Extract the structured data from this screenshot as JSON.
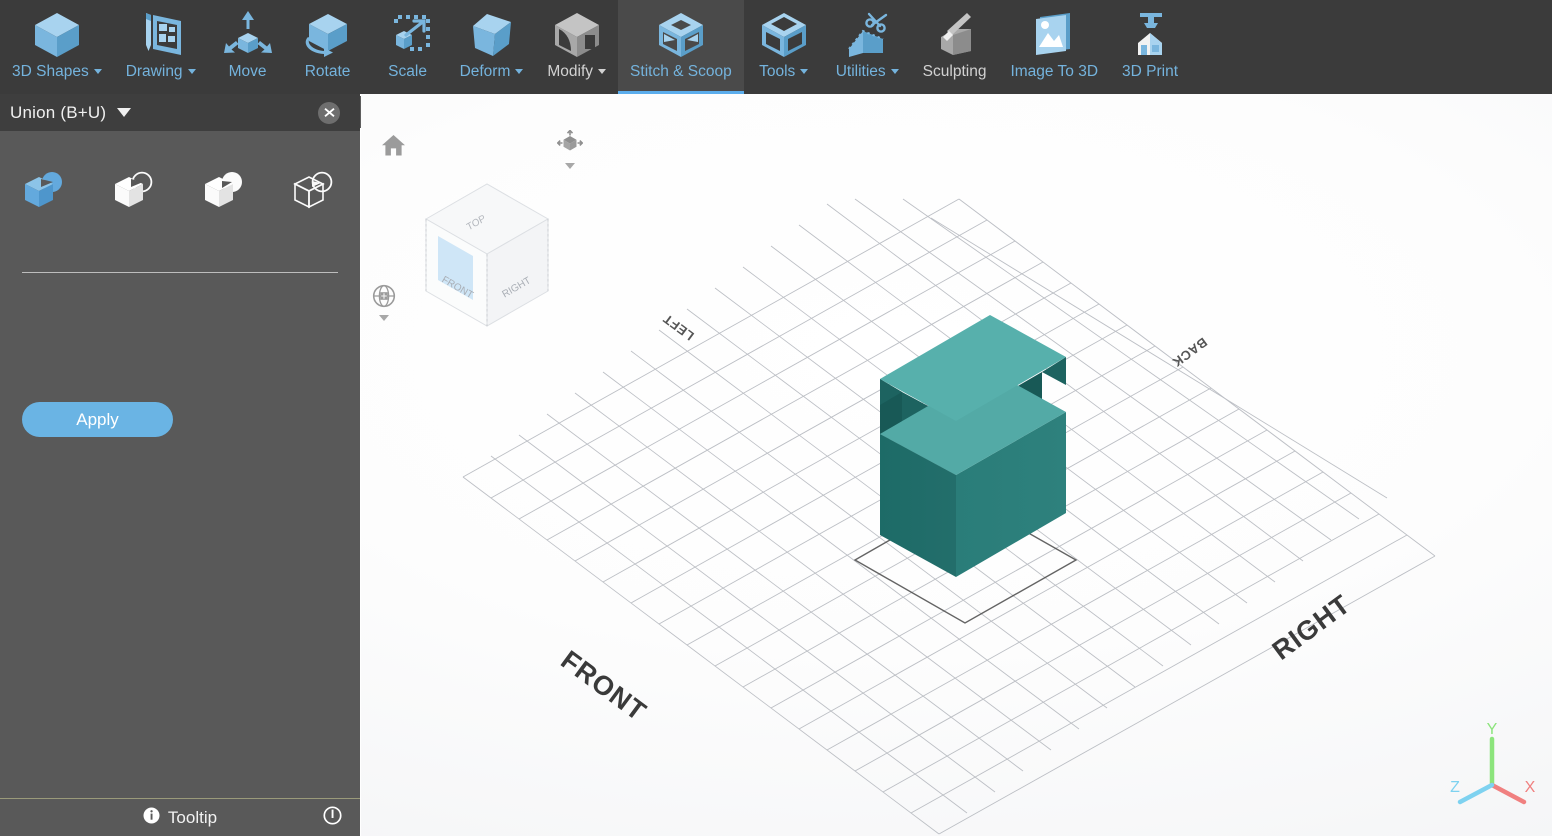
{
  "app": {
    "accent_blue": "#74b3dd",
    "toolbar_bg": "#3b3b3b",
    "panel_bg": "#595959",
    "apply_blue": "#6ab4e4",
    "model_color_top": "#53aaa6",
    "model_color_side": "#1f6b68"
  },
  "toolbar": {
    "items": [
      {
        "label": "3D Shapes",
        "icon": "cube-icon",
        "has_caret": true,
        "style": "blue",
        "active": false
      },
      {
        "label": "Drawing",
        "icon": "pencil-blueprint-icon",
        "has_caret": true,
        "style": "blue",
        "active": false
      },
      {
        "label": "Move",
        "icon": "move-arrows-cube-icon",
        "has_caret": false,
        "style": "blue",
        "active": false
      },
      {
        "label": "Rotate",
        "icon": "rotate-cube-icon",
        "has_caret": false,
        "style": "blue",
        "active": false
      },
      {
        "label": "Scale",
        "icon": "scale-cube-icon",
        "has_caret": false,
        "style": "blue",
        "active": false
      },
      {
        "label": "Deform",
        "icon": "deform-cube-icon",
        "has_caret": true,
        "style": "blue",
        "active": false
      },
      {
        "label": "Modify",
        "icon": "modify-cube-icon",
        "has_caret": true,
        "style": "gray",
        "active": false
      },
      {
        "label": "Stitch & Scoop",
        "icon": "stitch-scoop-cube-icon",
        "has_caret": false,
        "style": "blue",
        "active": true
      },
      {
        "label": "Tools",
        "icon": "tools-cube-icon",
        "has_caret": true,
        "style": "blue",
        "active": false
      },
      {
        "label": "Utilities",
        "icon": "scissors-utilities-icon",
        "has_caret": true,
        "style": "blue",
        "active": false
      },
      {
        "label": "Sculpting",
        "icon": "sculpting-chisel-icon",
        "has_caret": false,
        "style": "gray",
        "active": false
      },
      {
        "label": "Image To 3D",
        "icon": "image-to-3d-icon",
        "has_caret": false,
        "style": "blue",
        "active": false
      },
      {
        "label": "3D Print",
        "icon": "3d-printer-icon",
        "has_caret": false,
        "style": "blue",
        "active": false
      }
    ]
  },
  "panel": {
    "title": "Union (B+U)",
    "close_icon": "close-icon",
    "title_caret_icon": "chevron-down-icon",
    "operations": [
      {
        "name": "union",
        "icon": "union-boolean-icon",
        "selected": true
      },
      {
        "name": "subtract",
        "icon": "subtract-boolean-icon",
        "selected": false
      },
      {
        "name": "intersect",
        "icon": "intersect-boolean-icon",
        "selected": false
      },
      {
        "name": "exclude",
        "icon": "exclude-boolean-icon",
        "selected": false
      }
    ],
    "apply_label": "Apply",
    "footer": {
      "info_icon": "info-circle-icon",
      "tooltip_label": "Tooltip",
      "right_icon": "power-info-icon"
    },
    "collapse_icon": "chevron-left-icon"
  },
  "viewport": {
    "home_icon": "home-icon",
    "orient_icon": "view-orientation-icon",
    "orbit_icon": "orbit-globe-icon",
    "orient_caret_icon": "chevron-down-icon",
    "orbit_caret_icon": "chevron-down-icon",
    "viewcube": {
      "name": "view-cube",
      "faces": {
        "top": "TOP",
        "front": "FRONT",
        "right": "RIGHT"
      },
      "highlighted_face": "FRONT"
    },
    "ground_labels": {
      "front": "FRONT",
      "back": "BACK",
      "left": "LEFT",
      "right": "RIGHT"
    },
    "axis_gizmo": {
      "x": {
        "label": "X",
        "color": "#f08080"
      },
      "y": {
        "label": "Y",
        "color": "#8ce47c"
      },
      "z": {
        "label": "Z",
        "color": "#7ed2f0"
      }
    },
    "model": {
      "name": "union-result-mesh",
      "description": "teal boolean union of two cubes"
    }
  }
}
